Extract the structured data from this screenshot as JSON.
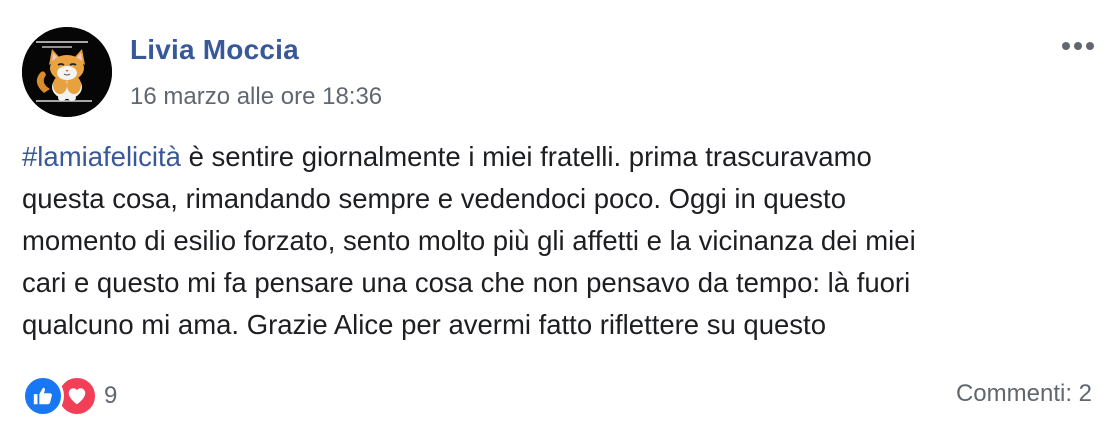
{
  "post": {
    "author": "Livia Moccia",
    "timestamp": "16 marzo alle ore 18:36",
    "hashtag": "#lamiafelicità",
    "text": " è sentire giornalmente i miei fratelli. prima trascuravamo\nquesta cosa, rimandando sempre e vedendoci poco. Oggi in questo\nmomento di esilio forzato, sento molto più gli affetti e la vicinanza dei miei\ncari e questo mi fa pensare una cosa che non pensavo da tempo: là fuori\nqualcuno mi ama. Grazie Alice per avermi fatto riflettere su questo",
    "reactions": {
      "icons": [
        "like-icon",
        "love-icon"
      ],
      "count": "9"
    },
    "comments_label": "Commenti: 2",
    "more_icon": "more-options-icon"
  },
  "colors": {
    "author": "#385898",
    "hashtag": "#385898",
    "meta": "#616770",
    "like": "#1877f2",
    "love": "#f33e58"
  }
}
